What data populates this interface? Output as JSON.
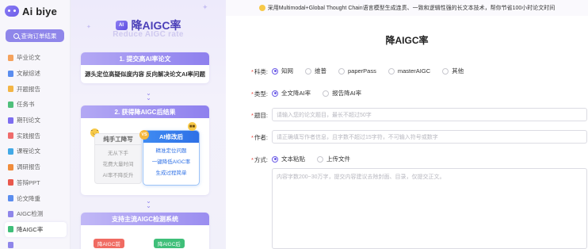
{
  "brand": {
    "name": "Ai biye"
  },
  "sidebar": {
    "query_button": "查询订单结果",
    "items": [
      {
        "label": "毕业论文",
        "color": "#f5a25d"
      },
      {
        "label": "文献综述",
        "color": "#5b8def"
      },
      {
        "label": "开题报告",
        "color": "#f3b545"
      },
      {
        "label": "任务书",
        "color": "#4fbf7b"
      },
      {
        "label": "期刊论文",
        "color": "#7d6df0"
      },
      {
        "label": "实践报告",
        "color": "#ef6b6b"
      },
      {
        "label": "课程论文",
        "color": "#43a9e6"
      },
      {
        "label": "调研报告",
        "color": "#f08c3c"
      },
      {
        "label": "答辩PPT",
        "color": "#e9584d"
      },
      {
        "label": "论文降重",
        "color": "#5b8def"
      },
      {
        "label": "AIGC检测",
        "color": "#8f86ea"
      },
      {
        "label": "降AIGC率",
        "color": "#3fbf79"
      },
      {
        "label": "",
        "color": "#8f86ea"
      }
    ],
    "active_index": 11
  },
  "promo": {
    "title": "降AIGC率",
    "badge": "AI",
    "ghost_text": "Reduce AIGC rate",
    "step1": {
      "head": "1. 提交高AI率论文",
      "body": "源头定位高疑似度内容 反向解决论文AI率问题"
    },
    "step2": {
      "head": "2. 获得降AIGC后结果"
    },
    "compare": {
      "vs": "VS",
      "left": {
        "title": "纯手工降写",
        "lines": [
          "无从下手",
          "花费大量时间",
          "AI率不降反升"
        ]
      },
      "right": {
        "title": "AI修改后",
        "lines": [
          "精准定位问题",
          "一键降低AIGC率",
          "生成过程简单"
        ]
      }
    },
    "step3": {
      "head": "支持主流AIGC检测系统"
    },
    "tags": [
      "降AIGC前",
      "降AIGC后"
    ]
  },
  "main": {
    "banner": "采用Multimodal+Global Thought Chain语言模型生成连贯、一致和逻辑性强的长文本技术，帮你节省100小时论文时间",
    "title": "降AIGC率",
    "subject": {
      "label": "科类:",
      "options": [
        "知网",
        "维普",
        "paperPass",
        "masterAIGC",
        "其他"
      ],
      "selected": 0
    },
    "type": {
      "label": "类型:",
      "options": [
        "全文降AI率",
        "报告降AI率"
      ],
      "selected": 0
    },
    "topic": {
      "label": "题目:",
      "placeholder": "请输入您的论文题目，最长不超过50字"
    },
    "author": {
      "label": "作者:",
      "placeholder": "请正确填写作者信息，且字数不超过15字符，不可输入符号或数字"
    },
    "method": {
      "label": "方式:",
      "options": [
        "文本粘贴",
        "上传文件"
      ],
      "selected": 0
    },
    "content": {
      "placeholder": "内容字数200~30万字，提交内容建议去除封面、目录，仅提交正文。"
    }
  },
  "colors": {
    "accent": "#6c5ce7",
    "required": "#e8463d",
    "blue": "#2e70e6"
  }
}
